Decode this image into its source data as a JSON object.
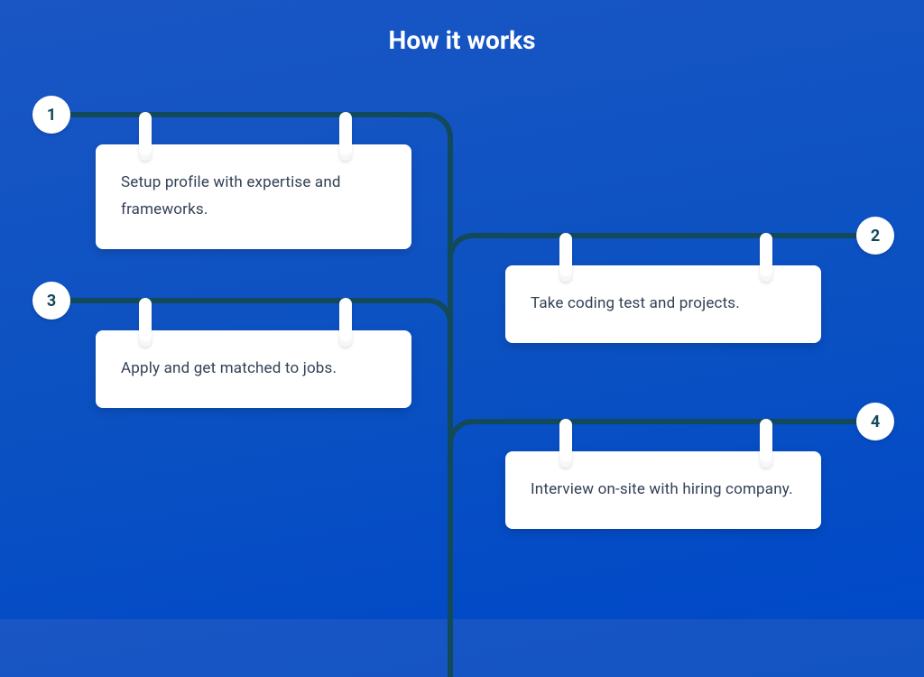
{
  "title": "How it works",
  "colors": {
    "line": "#124a5c",
    "card_bg": "#ffffff",
    "text": "#334155"
  },
  "steps": {
    "s1": {
      "num": "1",
      "text": "Setup profile with expertise and frameworks."
    },
    "s2": {
      "num": "2",
      "text": "Take coding test and projects."
    },
    "s3": {
      "num": "3",
      "text": "Apply and get matched to jobs."
    },
    "s4": {
      "num": "4",
      "text": "Interview on-site with hiring company."
    }
  }
}
